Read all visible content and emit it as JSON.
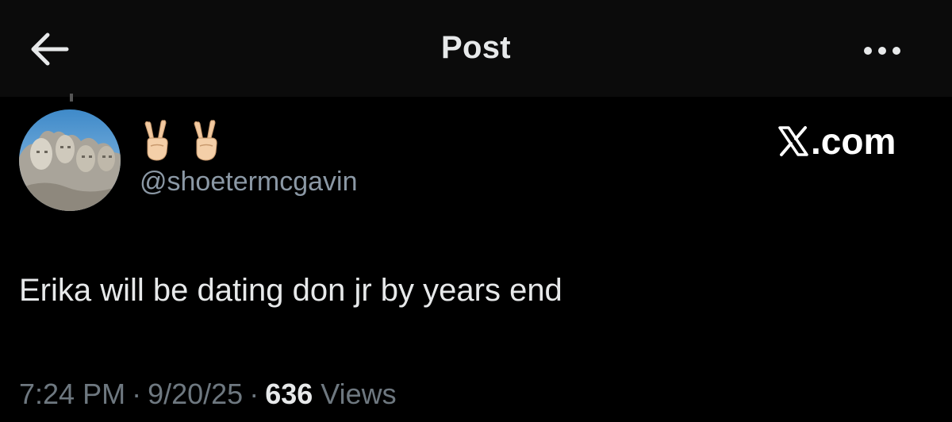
{
  "header": {
    "title": "Post",
    "back_icon": "arrow-left-icon",
    "more_icon": "more-horizontal-icon"
  },
  "author": {
    "display_name_icons": [
      "victory-hand-emoji",
      "victory-hand-emoji"
    ],
    "handle": "@shoetermcgavin",
    "avatar": "mount-rushmore-avatar"
  },
  "brand": {
    "text": ".com",
    "logo_icon": "x-logo-icon"
  },
  "post": {
    "text": "Erika will be dating don jr by years end"
  },
  "meta": {
    "time": "7:24 PM",
    "date": "9/20/25",
    "views_count": "636",
    "views_label": "Views",
    "separator": "·"
  },
  "colors": {
    "background": "#000000",
    "header_bg": "#0b0b0b",
    "text_primary": "#e7e9ea",
    "text_secondary": "#8b98a5",
    "meta_text": "#6e7880"
  }
}
